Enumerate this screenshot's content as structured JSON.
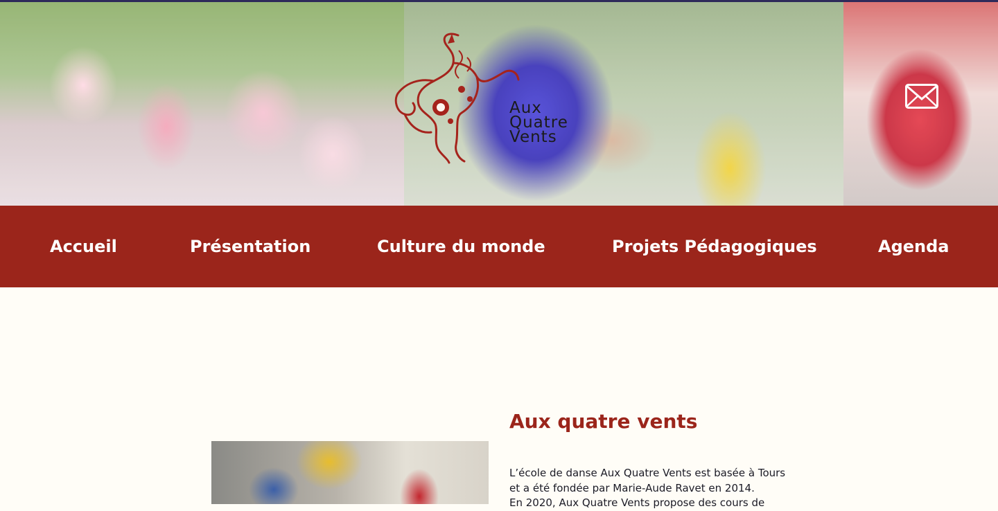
{
  "brand": {
    "logo_lines": [
      "Aux",
      "Quatre",
      "Vents"
    ],
    "accent_color": "#9b251b",
    "logo_icon": "horse-icon"
  },
  "header": {
    "contact_icon": "envelope-icon"
  },
  "nav": {
    "items": [
      {
        "label": "Accueil"
      },
      {
        "label": "Présentation"
      },
      {
        "label": "Culture du monde"
      },
      {
        "label": "Projets Pédagogiques"
      },
      {
        "label": "Agenda"
      }
    ]
  },
  "main": {
    "title": "Aux quatre vents",
    "paragraph_lines": [
      "L’école de danse Aux Quatre Vents est basée à Tours",
      "et a été fondée par Marie-Aude Ravet en 2014.",
      "En 2020, Aux Quatre Vents propose des cours de"
    ]
  }
}
